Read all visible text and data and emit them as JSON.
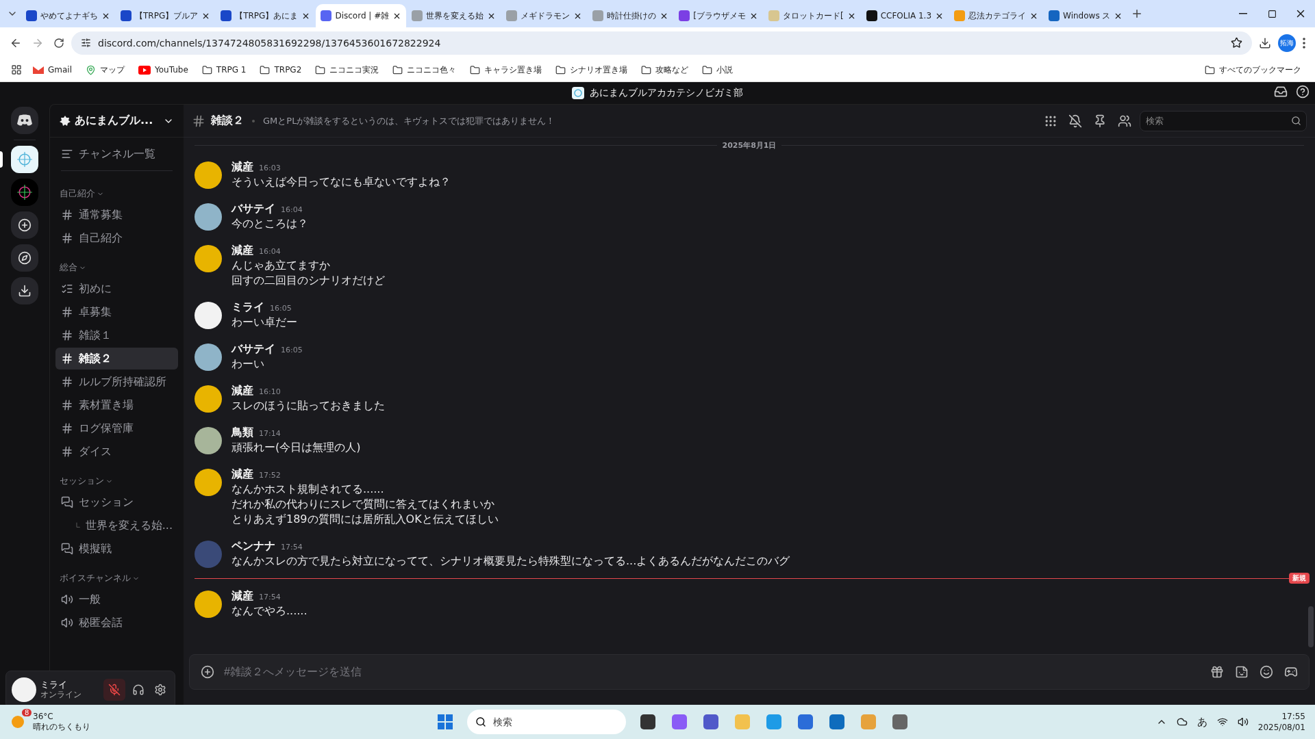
{
  "browser": {
    "tabs": [
      {
        "title": "やめてよナギち",
        "selected": false,
        "color": "#1a47c8"
      },
      {
        "title": "【TRPG】ブルア",
        "selected": false,
        "color": "#1a47c8"
      },
      {
        "title": "【TRPG】あにま",
        "selected": false,
        "color": "#1a47c8"
      },
      {
        "title": "Discord | #雑",
        "selected": true,
        "color": "#5865f2"
      },
      {
        "title": "世界を変える始",
        "selected": false,
        "color": "#9aa0a6"
      },
      {
        "title": "メギドラモン",
        "selected": false,
        "color": "#9aa0a6"
      },
      {
        "title": "時計仕掛けの",
        "selected": false,
        "color": "#9aa0a6"
      },
      {
        "title": "[ブラウザメモ",
        "selected": false,
        "color": "#7b3fe4"
      },
      {
        "title": "タロットカード[",
        "selected": false,
        "color": "#d8c690"
      },
      {
        "title": "CCFOLIA 1.3",
        "selected": false,
        "color": "#111111"
      },
      {
        "title": "忍法カテゴライ",
        "selected": false,
        "color": "#f39c12"
      },
      {
        "title": "Windows ス",
        "selected": false,
        "color": "#1565c0"
      }
    ],
    "url": "discord.com/channels/1374724805831692298/1376453601672822924",
    "profile": "拓海",
    "bookmarks": [
      {
        "label": "Gmail",
        "kind": "gmail"
      },
      {
        "label": "マップ",
        "kind": "maps"
      },
      {
        "label": "YouTube",
        "kind": "youtube"
      },
      {
        "label": "TRPG 1",
        "kind": "folder"
      },
      {
        "label": "TRPG2",
        "kind": "folder"
      },
      {
        "label": "ニコニコ実況",
        "kind": "folder"
      },
      {
        "label": "ニコニコ色々",
        "kind": "folder"
      },
      {
        "label": "キャラシ置き場",
        "kind": "folder"
      },
      {
        "label": "シナリオ置き場",
        "kind": "folder"
      },
      {
        "label": "攻略など",
        "kind": "folder"
      },
      {
        "label": "小説",
        "kind": "folder"
      }
    ],
    "all_bookmarks": "すべてのブックマーク"
  },
  "discord": {
    "title": "あにまんブルアカカテシノビガミ部",
    "servers": [
      {
        "kind": "home",
        "selected": false
      },
      {
        "kind": "server",
        "selected": true,
        "color": "#e8f6fb"
      },
      {
        "kind": "server",
        "selected": false,
        "color": "#000000"
      },
      {
        "kind": "add",
        "selected": false
      },
      {
        "kind": "discover",
        "selected": false
      },
      {
        "kind": "download",
        "selected": false
      }
    ],
    "server_name": "あにまんブル...",
    "channel_browser": "チャンネル一覧",
    "categories": [
      {
        "name": "自己紹介",
        "channels": [
          {
            "name": "通常募集",
            "kind": "text",
            "selected": false
          },
          {
            "name": "自己紹介",
            "kind": "text",
            "selected": false
          }
        ]
      },
      {
        "name": "総合",
        "channels": [
          {
            "name": "初めに",
            "kind": "rules",
            "selected": false
          },
          {
            "name": "卓募集",
            "kind": "text",
            "selected": false
          },
          {
            "name": "雑談１",
            "kind": "text",
            "selected": false
          },
          {
            "name": "雑談２",
            "kind": "text",
            "selected": true
          },
          {
            "name": "ルルブ所持確認所",
            "kind": "text",
            "selected": false
          },
          {
            "name": "素材置き場",
            "kind": "text",
            "selected": false
          },
          {
            "name": "ログ保管庫",
            "kind": "text",
            "selected": false
          },
          {
            "name": "ダイス",
            "kind": "text",
            "selected": false
          }
        ]
      },
      {
        "name": "セッション",
        "channels": [
          {
            "name": "セッション",
            "kind": "forum",
            "selected": false,
            "children": [
              {
                "name": "世界を変える始...",
                "kind": "thread",
                "selected": false
              }
            ]
          },
          {
            "name": "模擬戦",
            "kind": "forum",
            "selected": false
          }
        ]
      },
      {
        "name": "ボイスチャンネル",
        "channels": [
          {
            "name": "一般",
            "kind": "voice",
            "selected": false
          },
          {
            "name": "秘匿会話",
            "kind": "voice",
            "selected": false
          }
        ]
      }
    ],
    "user": {
      "name": "ミライ",
      "status": "オンライン",
      "muted": true
    },
    "channel": {
      "name": "雑談２",
      "topic": "GMとPLが雑談をするというのは、キヴォトスでは犯罪ではありません！"
    },
    "search": {
      "placeholder": "検索"
    },
    "date_divider": "2025年8月1日",
    "feed": [
      {
        "kind": "message",
        "author": "減産",
        "time": "16:03",
        "color": "#e8b400",
        "lines": [
          "そういえば今日ってなにも卓ないですよね？"
        ]
      },
      {
        "kind": "message",
        "author": "バサテイ",
        "time": "16:04",
        "color": "#8fb4c8",
        "lines": [
          "今のところは？"
        ]
      },
      {
        "kind": "message",
        "author": "減産",
        "time": "16:04",
        "color": "#e8b400",
        "lines": [
          "んじゃあ立てますか",
          "回すの二回目のシナリオだけど"
        ]
      },
      {
        "kind": "message",
        "author": "ミライ",
        "time": "16:05",
        "color": "#f2f2f2",
        "lines": [
          "わーい卓だー"
        ]
      },
      {
        "kind": "message",
        "author": "バサテイ",
        "time": "16:05",
        "color": "#8fb4c8",
        "lines": [
          "わーい"
        ]
      },
      {
        "kind": "message",
        "author": "減産",
        "time": "16:10",
        "color": "#e8b400",
        "lines": [
          "スレのほうに貼っておきました"
        ]
      },
      {
        "kind": "message",
        "author": "鳥類",
        "time": "17:14",
        "color": "#a7b59a",
        "lines": [
          "頑張れー(今日は無理の人)"
        ]
      },
      {
        "kind": "message",
        "author": "減産",
        "time": "17:52",
        "color": "#e8b400",
        "lines": [
          "なんかホスト規制されてる......",
          "だれか私の代わりにスレで質問に答えてはくれまいか",
          "とりあえず189の質問には居所乱入OKと伝えてほしい"
        ]
      },
      {
        "kind": "message",
        "author": "ペンナナ",
        "time": "17:54",
        "color": "#3a4a78",
        "lines": [
          "なんかスレの方で見たら対立になってて、シナリオ概要見たら特殊型になってる...よくあるんだがなんだこのバグ"
        ]
      },
      {
        "kind": "new_divider",
        "label": "新規"
      },
      {
        "kind": "message",
        "author": "減産",
        "time": "17:54",
        "color": "#e8b400",
        "lines": [
          "なんでやろ......"
        ]
      }
    ],
    "composer": {
      "placeholder": "#雑談２へメッセージを送信"
    }
  },
  "taskbar": {
    "weather_badge": "8",
    "temperature": "36°C",
    "condition": "晴れのちくもり",
    "search_placeholder": "検索",
    "ime": "あ",
    "time": "17:55",
    "date": "2025/08/01"
  }
}
